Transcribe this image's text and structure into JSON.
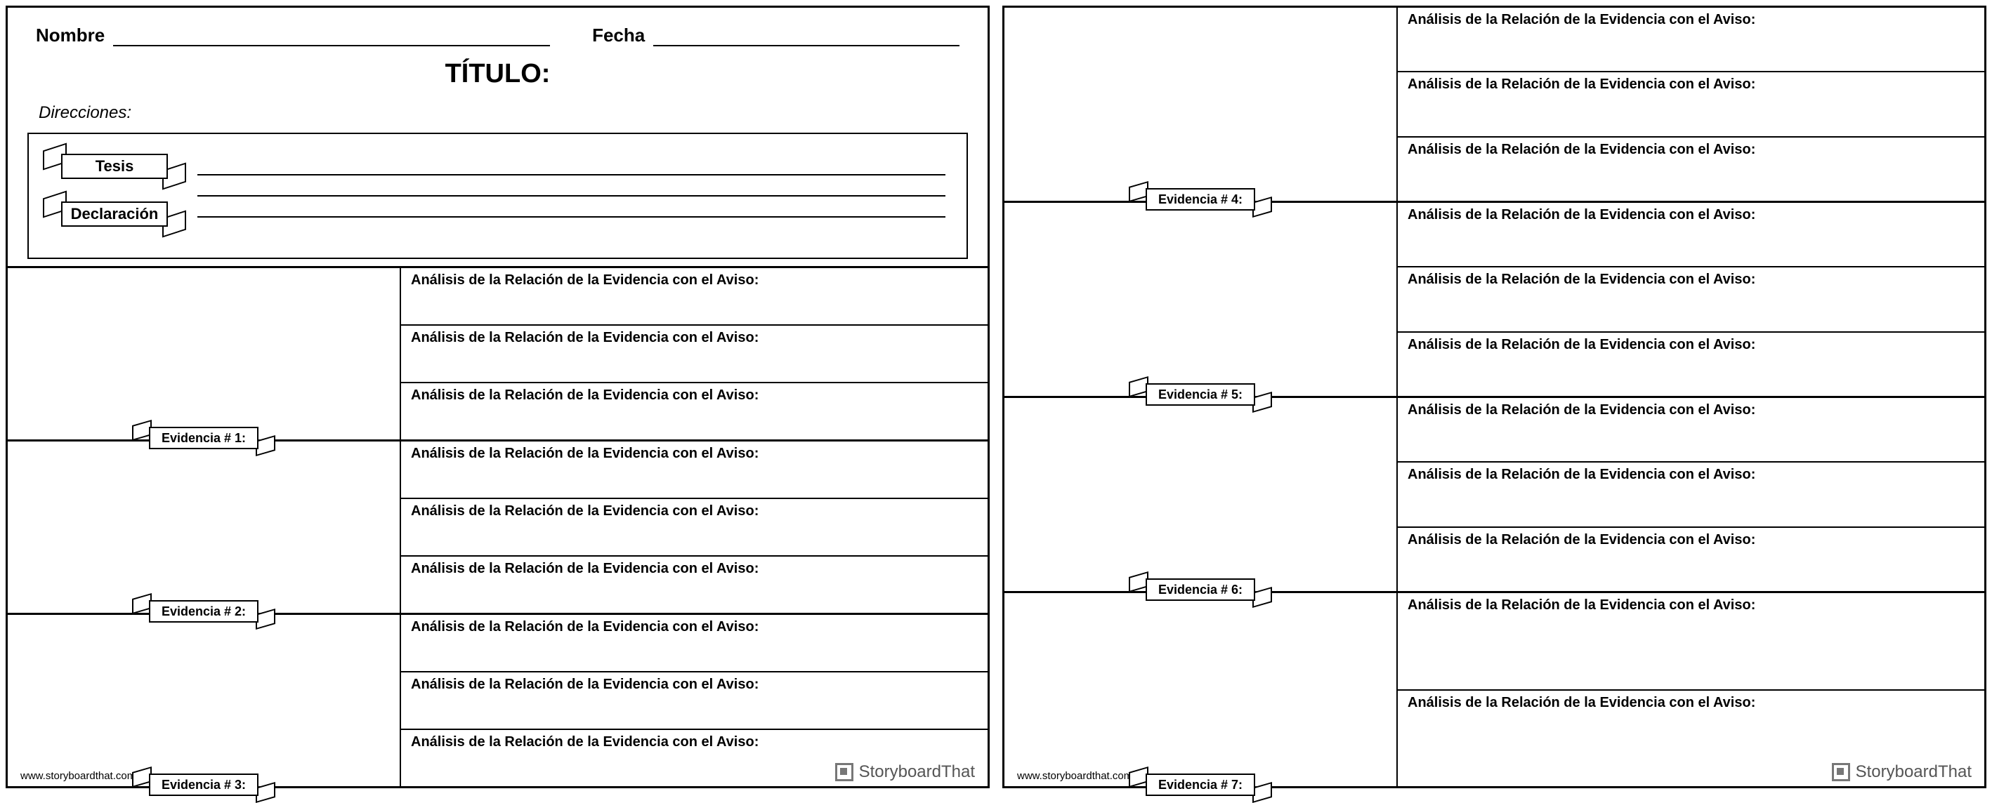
{
  "header": {
    "name_label": "Nombre",
    "date_label": "Fecha",
    "title": "TÍTULO:",
    "directions_label": "Direcciones:"
  },
  "thesis_banner": {
    "line1": "Tesis",
    "line2": "Declaración"
  },
  "analysis_label": "Análisis de la Relación de la Evidencia con el Aviso:",
  "evidence_label_prefix": "Evidencia # ",
  "page1_evidence": [
    1,
    2,
    3
  ],
  "page2_evidence": [
    4,
    5,
    6,
    7
  ],
  "footer": {
    "url": "www.storyboardthat.com",
    "brand": "StoryboardThat"
  }
}
